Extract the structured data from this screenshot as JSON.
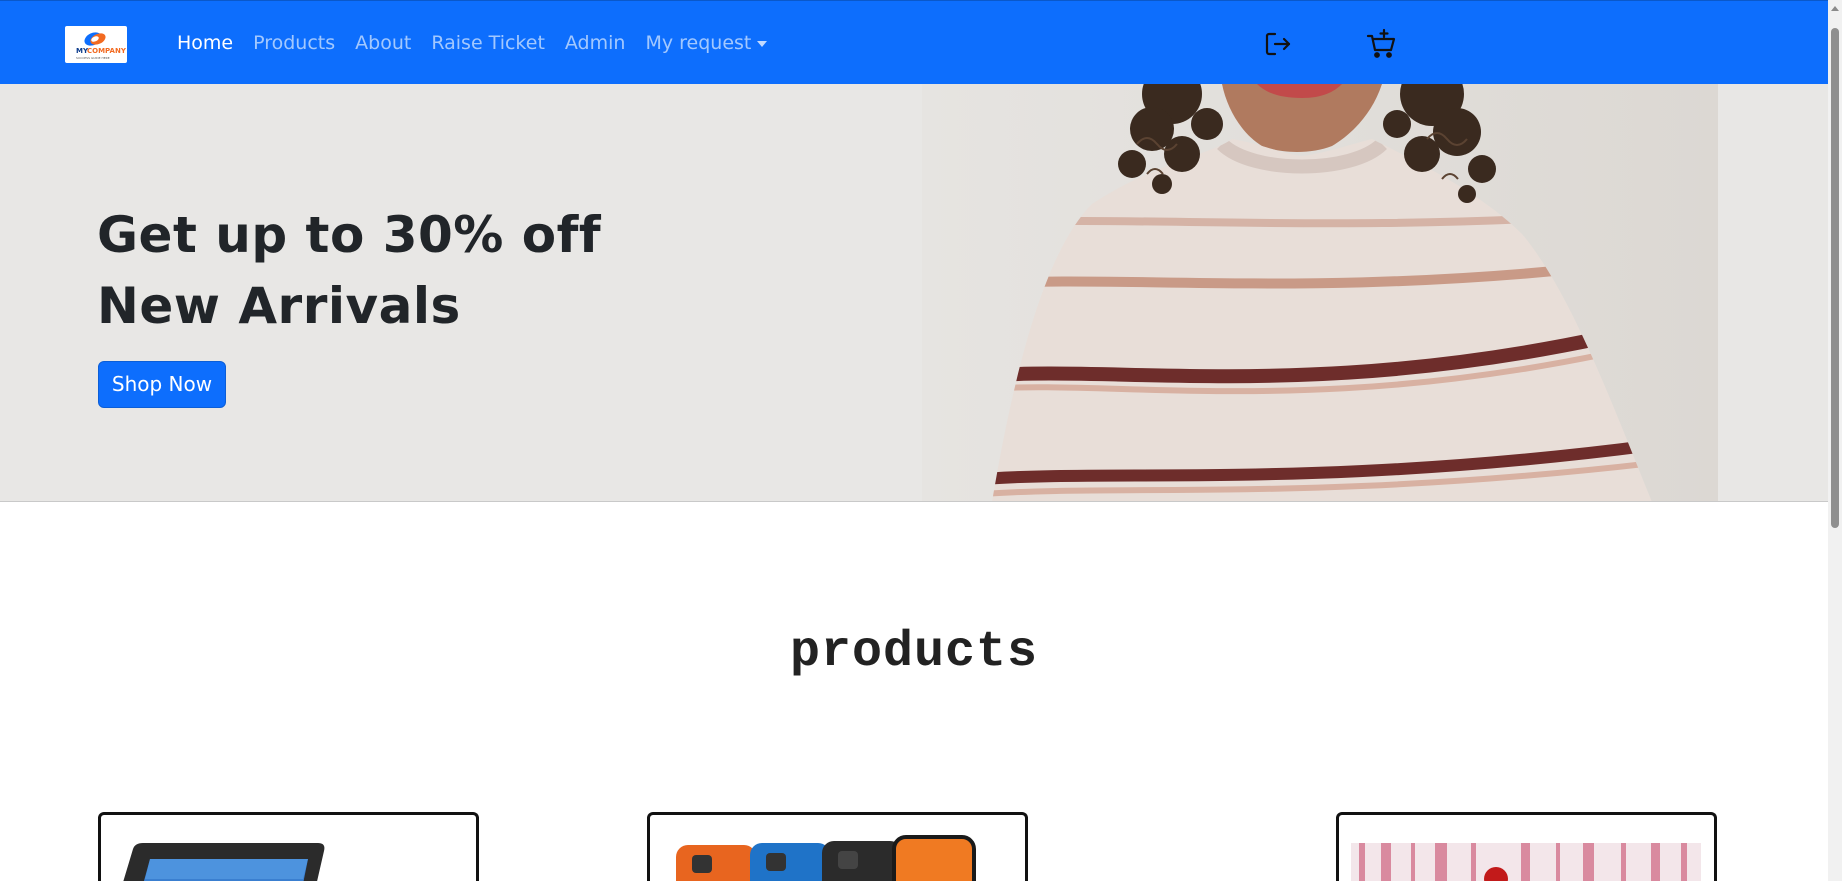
{
  "navbar": {
    "brand": {
      "line1_a": "MY",
      "line1_b": "COMPANY",
      "tagline": "SUCCESS GUIDE HERE"
    },
    "links": [
      {
        "label": "Home",
        "active": true
      },
      {
        "label": "Products"
      },
      {
        "label": "About"
      },
      {
        "label": "Raise Ticket"
      },
      {
        "label": "Admin"
      },
      {
        "label": "My request",
        "dropdown": true
      }
    ],
    "icons": [
      "logout-icon",
      "cart-add-icon"
    ],
    "color": "#0d6efd"
  },
  "hero": {
    "title_line1": "Get up to 30% off",
    "title_line2": "New Arrivals",
    "cta_label": "Shop Now",
    "background": "#e8e7e5"
  },
  "products": {
    "title": "products",
    "cards": [
      {
        "image": "tablet"
      },
      {
        "image": "phones"
      },
      {
        "image": "red-object"
      }
    ]
  }
}
